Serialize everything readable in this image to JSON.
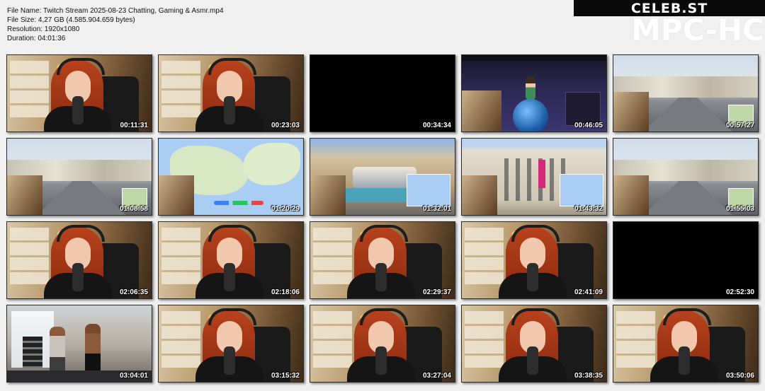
{
  "info": {
    "file_name": "File Name: Twitch Stream 2025-08-23 Chatting, Gaming & Asmr.mp4",
    "file_size": "File Size: 4,27 GB (4.585.904.659 bytes)",
    "resolution": "Resolution: 1920x1080",
    "duration": "Duration: 04:01:36"
  },
  "brand": {
    "site": "CELEB.ST",
    "player": "MPC-HC"
  },
  "thumbnails": [
    {
      "time": "00:11:31",
      "scene": "room"
    },
    {
      "time": "00:23:03",
      "scene": "room"
    },
    {
      "time": "00:34:34",
      "scene": "black"
    },
    {
      "time": "00:46:05",
      "scene": "purple"
    },
    {
      "time": "00:57:27",
      "scene": "street"
    },
    {
      "time": "01:08:58",
      "scene": "street"
    },
    {
      "time": "01:20:29",
      "scene": "map"
    },
    {
      "time": "01:32:01",
      "scene": "plaza"
    },
    {
      "time": "01:43:32",
      "scene": "building"
    },
    {
      "time": "01:55:03",
      "scene": "street"
    },
    {
      "time": "02:06:35",
      "scene": "room"
    },
    {
      "time": "02:18:06",
      "scene": "room"
    },
    {
      "time": "02:29:37",
      "scene": "room"
    },
    {
      "time": "02:41:09",
      "scene": "room"
    },
    {
      "time": "02:52:30",
      "scene": "black"
    },
    {
      "time": "03:04:01",
      "scene": "gym"
    },
    {
      "time": "03:15:32",
      "scene": "room"
    },
    {
      "time": "03:27:04",
      "scene": "room"
    },
    {
      "time": "03:38:35",
      "scene": "room"
    },
    {
      "time": "03:50:06",
      "scene": "room"
    }
  ]
}
